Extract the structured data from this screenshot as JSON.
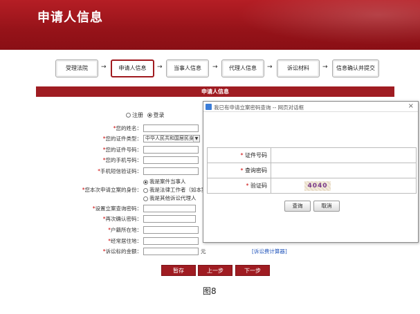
{
  "banner": {
    "title": "申请人信息"
  },
  "steps": [
    {
      "label": "受理法院",
      "active": false
    },
    {
      "label": "申请人信息",
      "active": true
    },
    {
      "label": "当事人信息",
      "active": false
    },
    {
      "label": "代理人信息",
      "active": false
    },
    {
      "label": "诉讼材料",
      "active": false
    },
    {
      "label": "信息确认并提交",
      "active": false
    }
  ],
  "arrow_glyph": "→",
  "section_title": "申请人信息",
  "mode": {
    "options": [
      "注册",
      "登录"
    ],
    "selected": "登录"
  },
  "required_mark": "*",
  "fields": {
    "name": "您的姓名：",
    "id_type": "您的证件类型：",
    "id_type_value": "中华人民共和国居民身",
    "id_number": "您的证件号码：",
    "phone": "您的手机号码：",
    "sms_code": "手机短信验证码：",
    "identity": "您本次申请立案的身份：",
    "identity_options": [
      "我是案件当事人",
      "我是法律工作者（如本案",
      "我是其他诉讼代理人"
    ],
    "identity_selected": 0,
    "query_pwd": "设置立案查询密码：",
    "confirm_pwd": "再次确认密码：",
    "household": "户籍所在地：",
    "residence": "经常居住地：",
    "amount": "诉讼标的金额：",
    "amount_unit": "元",
    "calc_link": "[诉讼费计算器]"
  },
  "buttons": {
    "save": "暂存",
    "prev": "上一步",
    "next": "下一步"
  },
  "figure_caption": "图8",
  "dialog": {
    "title": "我已有申请立案密码查询 -- 网页对话框",
    "close": "×",
    "rows": [
      {
        "label": "证件号码"
      },
      {
        "label": "查询密码"
      },
      {
        "label": "验证码"
      }
    ],
    "captcha_text": "4040",
    "query_btn": "查询",
    "cancel_btn": "取消"
  },
  "colors": {
    "brand_red": "#9f1c22",
    "link_blue": "#2255bb"
  }
}
